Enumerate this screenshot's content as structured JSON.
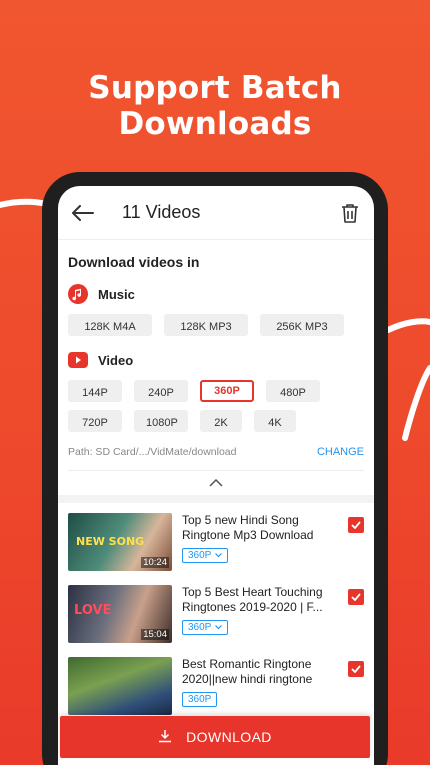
{
  "headline": "Support Batch Downloads",
  "appbar": {
    "title": "11 Videos",
    "back_icon": "arrow-left-icon",
    "delete_icon": "trash-icon"
  },
  "panel": {
    "title": "Download videos in",
    "music": {
      "label": "Music",
      "icon": "music-note-icon",
      "options": [
        "128K  M4A",
        "128K  MP3",
        "256K  MP3"
      ]
    },
    "video": {
      "label": "Video",
      "icon": "play-icon",
      "options": [
        "144P",
        "240P",
        "360P",
        "480P",
        "720P",
        "1080P",
        "2K",
        "4K"
      ],
      "selected": "360P"
    },
    "path": "Path: SD Card/.../VidMate/download",
    "change": "CHANGE"
  },
  "videos": [
    {
      "title": "Top 5 new Hindi Song Ringtone Mp3 Download",
      "duration": "10:24",
      "quality": "360P",
      "checked": true,
      "thumb_text": "NEW SONG"
    },
    {
      "title": "Top 5 Best Heart Touching Ringtones 2019-2020 | F...",
      "duration": "15:04",
      "quality": "360P",
      "checked": true,
      "thumb_text": "LOVE"
    },
    {
      "title": "Best Romantic Ringtone 2020||new hindi ringtone",
      "duration": "",
      "quality": "360P",
      "checked": true,
      "thumb_text": ""
    }
  ],
  "download_button": "DOWNLOAD",
  "colors": {
    "accent": "#e7352b",
    "link": "#2196f3",
    "background": "#ee4a2c"
  }
}
